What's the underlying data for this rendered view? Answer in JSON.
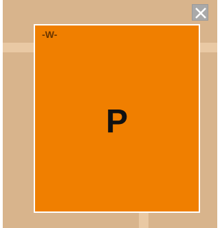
{
  "tile": {
    "tag": "-W-",
    "letter": "P"
  },
  "colors": {
    "board": "#d8b48c",
    "board_band": "#e9c9a4",
    "tile": "#f07f00",
    "tile_border": "#ffffff",
    "close_button": "#a9a9a9"
  },
  "icons": {
    "close": "close-icon"
  }
}
